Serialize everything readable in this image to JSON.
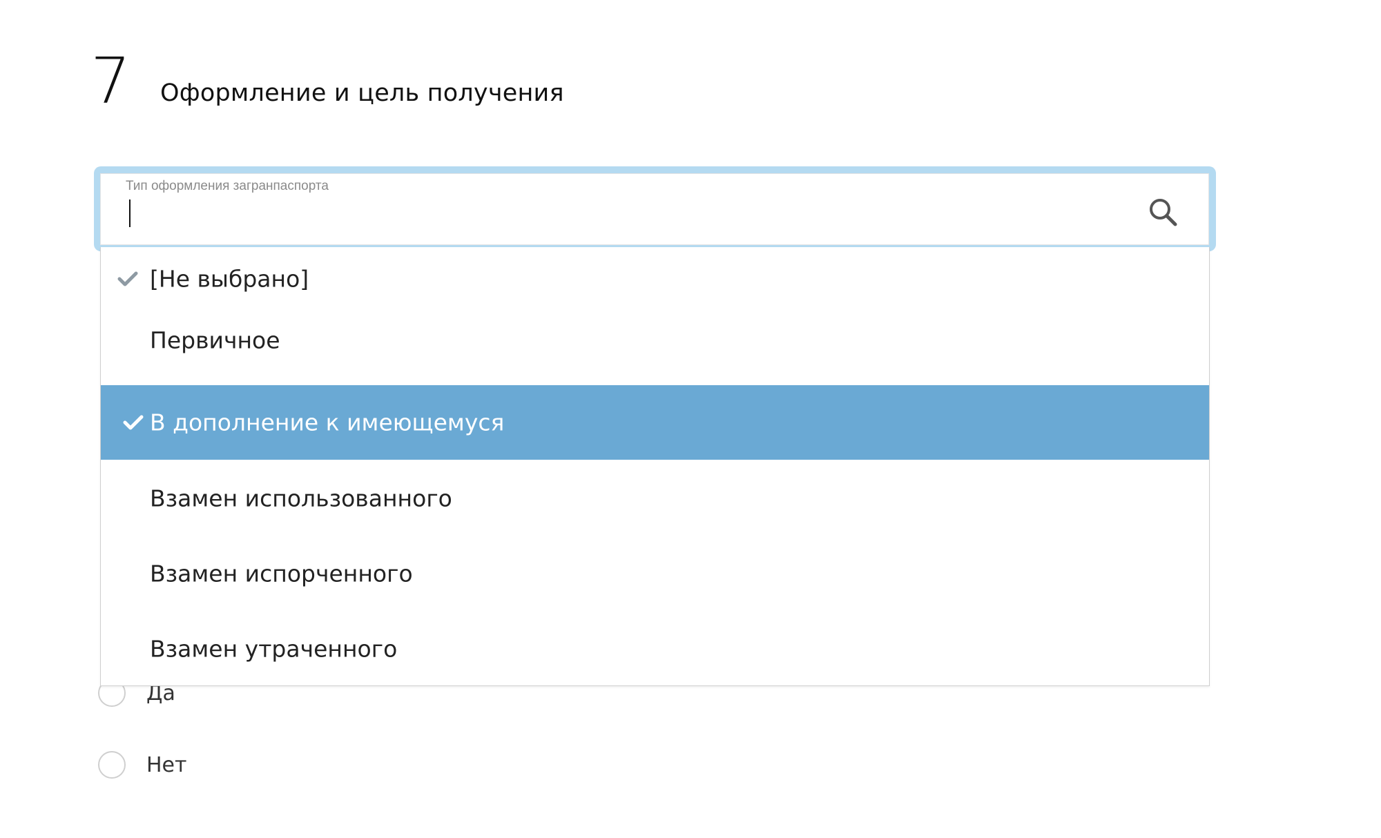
{
  "section": {
    "number": "7",
    "title": "Оформление и цель получения"
  },
  "field": {
    "label": "Тип оформления загранпаспорта",
    "value": "",
    "search_icon": "search-icon"
  },
  "dropdown": {
    "options": [
      {
        "label": "[Не выбрано]",
        "checked": true,
        "highlighted": false
      },
      {
        "label": "Первичное",
        "checked": false,
        "highlighted": false
      },
      {
        "label": "В дополнение к имеющемуся",
        "checked": true,
        "highlighted": true
      },
      {
        "label": "Взамен использованного",
        "checked": false,
        "highlighted": false
      },
      {
        "label": "Взамен испорченного",
        "checked": false,
        "highlighted": false
      },
      {
        "label": "Взамен утраченного",
        "checked": false,
        "highlighted": false
      }
    ],
    "highlight_color": "#6aa9d4"
  },
  "radio_group": {
    "options": [
      {
        "label": "Да",
        "selected": false
      },
      {
        "label": "Нет",
        "selected": false
      }
    ]
  },
  "colors": {
    "focus_ring": "#b4daf1",
    "check_icon_default": "#8e9aa3",
    "check_icon_selected": "#ffffff"
  }
}
